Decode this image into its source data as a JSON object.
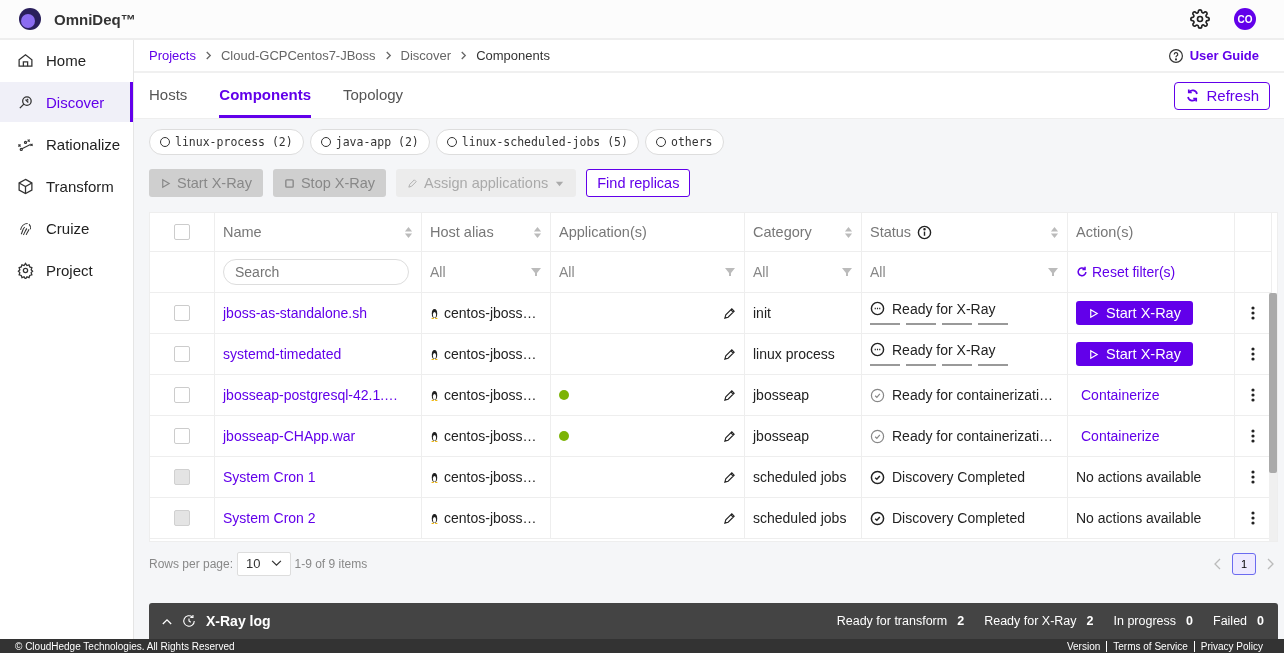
{
  "app": {
    "name": "OmniDeq™",
    "avatar": "CO"
  },
  "sidebar": {
    "items": [
      {
        "label": "Home",
        "selected": false
      },
      {
        "label": "Discover",
        "selected": true
      },
      {
        "label": "Rationalize",
        "selected": false
      },
      {
        "label": "Transform",
        "selected": false
      },
      {
        "label": "Cruize",
        "selected": false
      },
      {
        "label": "Project",
        "selected": false
      }
    ]
  },
  "breadcrumb": [
    {
      "label": "Projects",
      "link": true
    },
    {
      "label": "Cloud-GCPCentos7-JBoss",
      "link": false
    },
    {
      "label": "Discover",
      "link": false
    },
    {
      "label": "Components",
      "link": false
    }
  ],
  "user_guide": "User Guide",
  "tabs": [
    {
      "label": "Hosts",
      "selected": false
    },
    {
      "label": "Components",
      "selected": true
    },
    {
      "label": "Topology",
      "selected": false
    }
  ],
  "refresh": "Refresh",
  "filters": [
    {
      "label": "linux-process (2)",
      "selected": false
    },
    {
      "label": "java-app (2)",
      "selected": false
    },
    {
      "label": "linux-scheduled-jobs (5)",
      "selected": false
    },
    {
      "label": "others",
      "selected": false
    }
  ],
  "toolbar": [
    {
      "label": "Start X-Ray",
      "kind": "start",
      "disabled": true
    },
    {
      "label": "Stop X-Ray",
      "kind": "stop",
      "disabled": true
    },
    {
      "label": "Assign applications",
      "kind": "assign",
      "disabled": true
    },
    {
      "label": "Find replicas",
      "kind": "plain",
      "disabled": false
    }
  ],
  "table": {
    "select_all": {
      "checked": false
    },
    "columns": [
      "Name",
      "Host alias",
      "Application(s)",
      "Category",
      "Status",
      "Action(s)"
    ],
    "filters": {
      "search_placeholder": "Search",
      "host": "All",
      "application": "All",
      "category": "All",
      "status": "All",
      "reset": "Reset filter(s)"
    },
    "rows": [
      {
        "checked": false,
        "disabled": false,
        "name": "jboss-as-standalone.sh",
        "host": "centos-jboss…",
        "category": "init",
        "status": {
          "kind": "xray",
          "label": "Ready for X-Ray"
        },
        "action": {
          "kind": "button",
          "label": "Start X-Ray"
        }
      },
      {
        "checked": false,
        "disabled": false,
        "name": "systemd-timedated",
        "host": "centos-jboss…",
        "category": "linux process",
        "status": {
          "kind": "xray",
          "label": "Ready for X-Ray"
        },
        "action": {
          "kind": "button",
          "label": "Start X-Ray"
        }
      },
      {
        "checked": false,
        "disabled": false,
        "name": "jbosseap-postgresql-42.1.…",
        "host": "centos-jboss…",
        "application": {
          "color": "#7cb305"
        },
        "category": "jbosseap",
        "status": {
          "kind": "containerize",
          "label": "Ready for containerizati…"
        },
        "action": {
          "kind": "link",
          "label": "Containerize"
        }
      },
      {
        "checked": false,
        "disabled": false,
        "name": "jbosseap-CHApp.war",
        "host": "centos-jboss…",
        "application": {
          "color": "#7cb305"
        },
        "category": "jbosseap",
        "status": {
          "kind": "containerize",
          "label": "Ready for containerizati…"
        },
        "action": {
          "kind": "link",
          "label": "Containerize"
        }
      },
      {
        "checked": false,
        "disabled": true,
        "name": "System Cron 1",
        "host": "centos-jboss…",
        "category": "scheduled jobs",
        "status": {
          "kind": "completed",
          "label": "Discovery Completed"
        },
        "action": {
          "kind": "text",
          "label": "No actions available"
        }
      },
      {
        "checked": false,
        "disabled": true,
        "name": "System Cron 2",
        "host": "centos-jboss…",
        "category": "scheduled jobs",
        "status": {
          "kind": "completed",
          "label": "Discovery Completed"
        },
        "action": {
          "kind": "text",
          "label": "No actions available"
        }
      }
    ]
  },
  "pagination": {
    "rows_label": "Rows per page:",
    "page_size": "10",
    "range": "1-9 of 9 items",
    "pages": [
      {
        "label": "1",
        "selected": true
      }
    ]
  },
  "xray_log": {
    "title": "X-Ray log",
    "stats": [
      {
        "label": "Ready for transform",
        "count": "2"
      },
      {
        "label": "Ready for X-Ray",
        "count": "2"
      },
      {
        "label": "In progress",
        "count": "0"
      },
      {
        "label": "Failed",
        "count": "0"
      }
    ]
  },
  "footer": {
    "copyright": "© CloudHedge Technologies. All Rights Reserved",
    "links": [
      "Version",
      "Terms of Service",
      "Privacy Policy"
    ]
  }
}
